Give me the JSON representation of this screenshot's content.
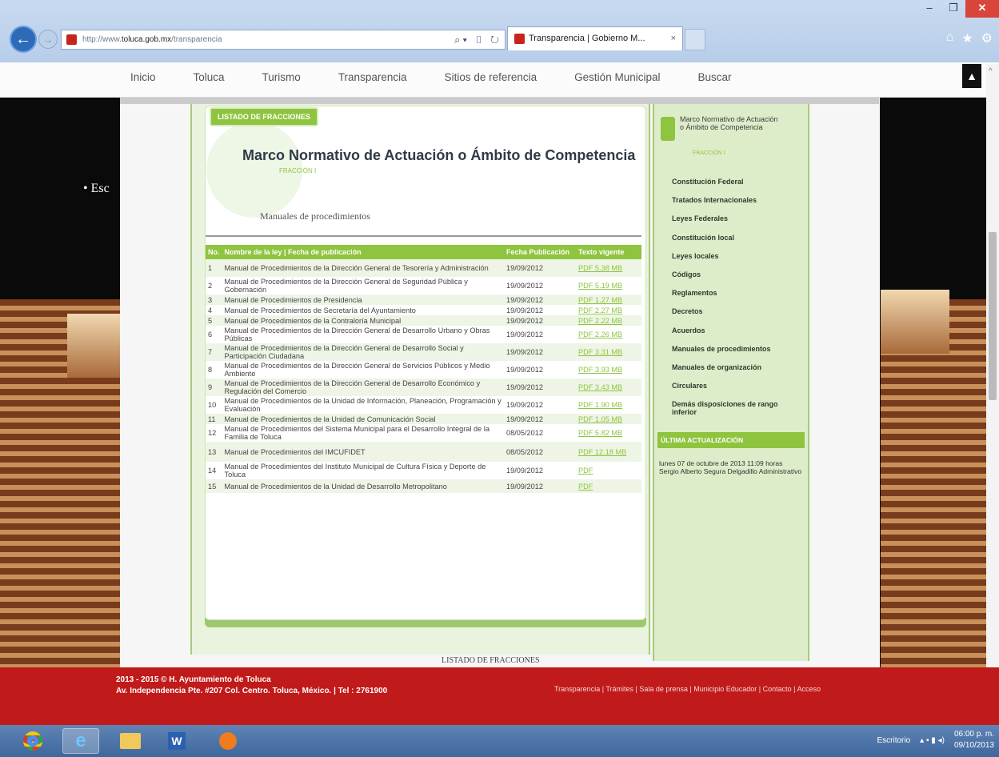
{
  "browser": {
    "url_prefix": "http://www.",
    "url_host": "toluca.gob.mx",
    "url_path": "/transparencia",
    "tab_title": "Transparencia | Gobierno M...",
    "tab_close": "×"
  },
  "nav": {
    "items": [
      "Inicio",
      "Toluca",
      "Turismo",
      "Transparencia",
      "Sitios de referencia",
      "Gestión Municipal",
      "Buscar"
    ]
  },
  "background_bullet": "• Esc",
  "content": {
    "listado_pill": "LISTADO DE FRACCIONES",
    "title": "Marco Normativo de Actuación o Ámbito de Competencia",
    "fraccion": "FRACCIÓN I",
    "subtitle": "Manuales de procedimientos",
    "table_headers": [
      "No.",
      "Nombre de la ley | Fecha de publicación",
      "Fecha Publicación",
      "Texto vigente"
    ],
    "rows": [
      {
        "no": "1",
        "name": "Manual de Procedimientos de la Dirección General de Tesorería y Administración",
        "date": "19/09/2012",
        "pdf": "PDF 5.38 MB"
      },
      {
        "no": "2",
        "name": "Manual de Procedimientos de la Dirección General de Seguridad Pública y Gobernación",
        "date": "19/09/2012",
        "pdf": "PDF 5.19 MB"
      },
      {
        "no": "3",
        "name": "Manual de Procedimientos de Presidencia",
        "date": "19/09/2012",
        "pdf": "PDF 1.27 MB"
      },
      {
        "no": "4",
        "name": "Manual de Procedimientos de Secretaría del Ayuntamiento",
        "date": "19/09/2012",
        "pdf": "PDF 2.27 MB"
      },
      {
        "no": "5",
        "name": "Manual de Procedimientos de la Contraloría Municipal",
        "date": "19/09/2012",
        "pdf": "PDF 2.22 MB"
      },
      {
        "no": "6",
        "name": "Manual de Procedimientos de la Dirección General de Desarrollo Urbano y Obras Públicas",
        "date": "19/09/2012",
        "pdf": "PDF 2.26 MB"
      },
      {
        "no": "7",
        "name": "Manual de Procedimientos de la Dirección General de Desarrollo Social y Participación Ciudadana",
        "date": "19/09/2012",
        "pdf": "PDF 3.31 MB"
      },
      {
        "no": "8",
        "name": "Manual de Procedimientos de la Dirección General de Servicios Públicos y Medio Ambiente",
        "date": "19/09/2012",
        "pdf": "PDF 3.93 MB"
      },
      {
        "no": "9",
        "name": "Manual de Procedimientos de la Dirección General de Desarrollo Económico y Regulación del Comercio",
        "date": "19/09/2012",
        "pdf": "PDF 3.43 MB"
      },
      {
        "no": "10",
        "name": "Manual de Procedimientos de la Unidad de Información, Planeación, Programación y Evaluación",
        "date": "19/09/2012",
        "pdf": "PDF 1.90 MB"
      },
      {
        "no": "11",
        "name": "Manual de Procedimientos de la Unidad de Comunicación Social",
        "date": "19/09/2012",
        "pdf": "PDF 1.05 MB"
      },
      {
        "no": "12",
        "name": "Manual de Procedimientos del Sistema Municipal para el Desarrollo Integral de la Familia de Toluca",
        "date": "08/05/2012",
        "pdf": "PDF 5.82 MB"
      },
      {
        "no": "13",
        "name": "Manual de Procedimientos del IMCUFIDET",
        "date": "08/05/2012",
        "pdf": "PDF 12.18 MB"
      },
      {
        "no": "14",
        "name": "Manual de Procedimientos del Instituto Municipal de Cultura Física y Deporte de Toluca",
        "date": "19/09/2012",
        "pdf": "PDF"
      },
      {
        "no": "15",
        "name": "Manual de Procedimientos de la Unidad de Desarrollo Metropolitano",
        "date": "19/09/2012",
        "pdf": "PDF"
      }
    ],
    "listado_bottom": "LISTADO DE FRACCIONES"
  },
  "sidebar": {
    "head": "Marco Normativo de Actuación o Ámbito de Competencia",
    "head_sub": "FRACCIÓN I",
    "links": [
      "Constitución Federal",
      "Tratados Internacionales",
      "Leyes Federales",
      "Constitución local",
      "Leyes locales",
      "Códigos",
      "Reglamentos",
      "Decretos",
      "Acuerdos",
      "Manuales de procedimientos",
      "Manuales de organización",
      "Circulares",
      "Demás disposiciones de rango inferior"
    ],
    "ultima_title": "ÚLTIMA ACTUALIZACIÓN",
    "ultima_text": "lunes 07 de octubre de 2013 11:09 horas Sergio Alberto Segura Delgadillo Administrativo"
  },
  "footer": {
    "line1": "2013 - 2015 © H. Ayuntamiento de Toluca",
    "line2": "Av. Independencia Pte. #207 Col. Centro. Toluca, México. | Tel : 2761900",
    "links": "Transparencia | Trámites | Sala de prensa | Municipio Educador | Contacto | Acceso"
  },
  "taskbar": {
    "desktop_label": "Escritorio",
    "time": "06:00 p. m.",
    "date": "09/10/2013"
  },
  "colors": {
    "accent_green": "#8fc43f",
    "footer_red": "#c11a1a"
  }
}
